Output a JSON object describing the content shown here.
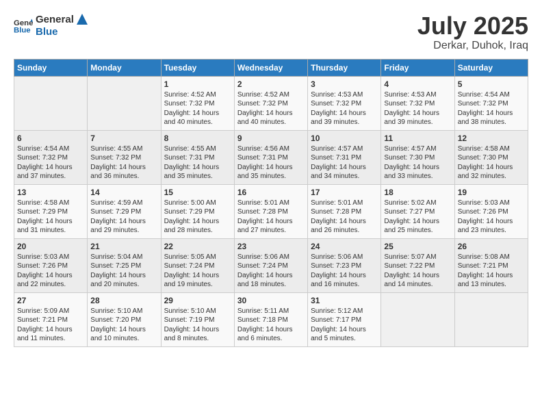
{
  "header": {
    "logo_general": "General",
    "logo_blue": "Blue",
    "title": "July 2025",
    "subtitle": "Derkar, Duhok, Iraq"
  },
  "days_of_week": [
    "Sunday",
    "Monday",
    "Tuesday",
    "Wednesday",
    "Thursday",
    "Friday",
    "Saturday"
  ],
  "weeks": [
    [
      {
        "day": "",
        "sunrise": "",
        "sunset": "",
        "daylight": ""
      },
      {
        "day": "",
        "sunrise": "",
        "sunset": "",
        "daylight": ""
      },
      {
        "day": "1",
        "sunrise": "Sunrise: 4:52 AM",
        "sunset": "Sunset: 7:32 PM",
        "daylight": "Daylight: 14 hours and 40 minutes."
      },
      {
        "day": "2",
        "sunrise": "Sunrise: 4:52 AM",
        "sunset": "Sunset: 7:32 PM",
        "daylight": "Daylight: 14 hours and 40 minutes."
      },
      {
        "day": "3",
        "sunrise": "Sunrise: 4:53 AM",
        "sunset": "Sunset: 7:32 PM",
        "daylight": "Daylight: 14 hours and 39 minutes."
      },
      {
        "day": "4",
        "sunrise": "Sunrise: 4:53 AM",
        "sunset": "Sunset: 7:32 PM",
        "daylight": "Daylight: 14 hours and 39 minutes."
      },
      {
        "day": "5",
        "sunrise": "Sunrise: 4:54 AM",
        "sunset": "Sunset: 7:32 PM",
        "daylight": "Daylight: 14 hours and 38 minutes."
      }
    ],
    [
      {
        "day": "6",
        "sunrise": "Sunrise: 4:54 AM",
        "sunset": "Sunset: 7:32 PM",
        "daylight": "Daylight: 14 hours and 37 minutes."
      },
      {
        "day": "7",
        "sunrise": "Sunrise: 4:55 AM",
        "sunset": "Sunset: 7:32 PM",
        "daylight": "Daylight: 14 hours and 36 minutes."
      },
      {
        "day": "8",
        "sunrise": "Sunrise: 4:55 AM",
        "sunset": "Sunset: 7:31 PM",
        "daylight": "Daylight: 14 hours and 35 minutes."
      },
      {
        "day": "9",
        "sunrise": "Sunrise: 4:56 AM",
        "sunset": "Sunset: 7:31 PM",
        "daylight": "Daylight: 14 hours and 35 minutes."
      },
      {
        "day": "10",
        "sunrise": "Sunrise: 4:57 AM",
        "sunset": "Sunset: 7:31 PM",
        "daylight": "Daylight: 14 hours and 34 minutes."
      },
      {
        "day": "11",
        "sunrise": "Sunrise: 4:57 AM",
        "sunset": "Sunset: 7:30 PM",
        "daylight": "Daylight: 14 hours and 33 minutes."
      },
      {
        "day": "12",
        "sunrise": "Sunrise: 4:58 AM",
        "sunset": "Sunset: 7:30 PM",
        "daylight": "Daylight: 14 hours and 32 minutes."
      }
    ],
    [
      {
        "day": "13",
        "sunrise": "Sunrise: 4:58 AM",
        "sunset": "Sunset: 7:29 PM",
        "daylight": "Daylight: 14 hours and 31 minutes."
      },
      {
        "day": "14",
        "sunrise": "Sunrise: 4:59 AM",
        "sunset": "Sunset: 7:29 PM",
        "daylight": "Daylight: 14 hours and 29 minutes."
      },
      {
        "day": "15",
        "sunrise": "Sunrise: 5:00 AM",
        "sunset": "Sunset: 7:29 PM",
        "daylight": "Daylight: 14 hours and 28 minutes."
      },
      {
        "day": "16",
        "sunrise": "Sunrise: 5:01 AM",
        "sunset": "Sunset: 7:28 PM",
        "daylight": "Daylight: 14 hours and 27 minutes."
      },
      {
        "day": "17",
        "sunrise": "Sunrise: 5:01 AM",
        "sunset": "Sunset: 7:28 PM",
        "daylight": "Daylight: 14 hours and 26 minutes."
      },
      {
        "day": "18",
        "sunrise": "Sunrise: 5:02 AM",
        "sunset": "Sunset: 7:27 PM",
        "daylight": "Daylight: 14 hours and 25 minutes."
      },
      {
        "day": "19",
        "sunrise": "Sunrise: 5:03 AM",
        "sunset": "Sunset: 7:26 PM",
        "daylight": "Daylight: 14 hours and 23 minutes."
      }
    ],
    [
      {
        "day": "20",
        "sunrise": "Sunrise: 5:03 AM",
        "sunset": "Sunset: 7:26 PM",
        "daylight": "Daylight: 14 hours and 22 minutes."
      },
      {
        "day": "21",
        "sunrise": "Sunrise: 5:04 AM",
        "sunset": "Sunset: 7:25 PM",
        "daylight": "Daylight: 14 hours and 20 minutes."
      },
      {
        "day": "22",
        "sunrise": "Sunrise: 5:05 AM",
        "sunset": "Sunset: 7:24 PM",
        "daylight": "Daylight: 14 hours and 19 minutes."
      },
      {
        "day": "23",
        "sunrise": "Sunrise: 5:06 AM",
        "sunset": "Sunset: 7:24 PM",
        "daylight": "Daylight: 14 hours and 18 minutes."
      },
      {
        "day": "24",
        "sunrise": "Sunrise: 5:06 AM",
        "sunset": "Sunset: 7:23 PM",
        "daylight": "Daylight: 14 hours and 16 minutes."
      },
      {
        "day": "25",
        "sunrise": "Sunrise: 5:07 AM",
        "sunset": "Sunset: 7:22 PM",
        "daylight": "Daylight: 14 hours and 14 minutes."
      },
      {
        "day": "26",
        "sunrise": "Sunrise: 5:08 AM",
        "sunset": "Sunset: 7:21 PM",
        "daylight": "Daylight: 14 hours and 13 minutes."
      }
    ],
    [
      {
        "day": "27",
        "sunrise": "Sunrise: 5:09 AM",
        "sunset": "Sunset: 7:21 PM",
        "daylight": "Daylight: 14 hours and 11 minutes."
      },
      {
        "day": "28",
        "sunrise": "Sunrise: 5:10 AM",
        "sunset": "Sunset: 7:20 PM",
        "daylight": "Daylight: 14 hours and 10 minutes."
      },
      {
        "day": "29",
        "sunrise": "Sunrise: 5:10 AM",
        "sunset": "Sunset: 7:19 PM",
        "daylight": "Daylight: 14 hours and 8 minutes."
      },
      {
        "day": "30",
        "sunrise": "Sunrise: 5:11 AM",
        "sunset": "Sunset: 7:18 PM",
        "daylight": "Daylight: 14 hours and 6 minutes."
      },
      {
        "day": "31",
        "sunrise": "Sunrise: 5:12 AM",
        "sunset": "Sunset: 7:17 PM",
        "daylight": "Daylight: 14 hours and 5 minutes."
      },
      {
        "day": "",
        "sunrise": "",
        "sunset": "",
        "daylight": ""
      },
      {
        "day": "",
        "sunrise": "",
        "sunset": "",
        "daylight": ""
      }
    ]
  ]
}
